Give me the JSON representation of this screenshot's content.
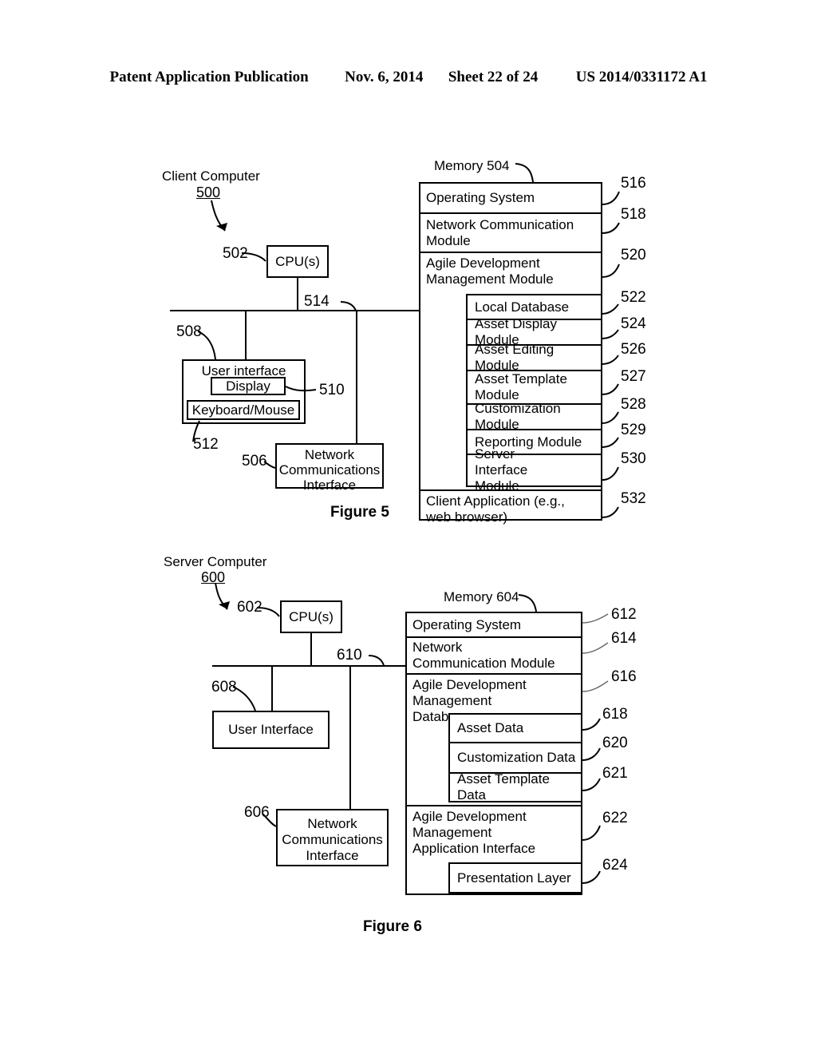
{
  "header": {
    "publication": "Patent Application Publication",
    "date": "Nov. 6, 2014",
    "sheet": "Sheet 22 of 24",
    "number": "US 2014/0331172 A1"
  },
  "figure5": {
    "caption": "Figure 5",
    "title": "Client Computer",
    "title_ref": "500",
    "cpu": {
      "label": "CPU(s)",
      "ref": "502"
    },
    "bus_ref": "514",
    "user_interface": {
      "label": "User interface",
      "ref": "508",
      "display": {
        "label": "Display",
        "ref": "510"
      },
      "keyboard": {
        "label": "Keyboard/Mouse",
        "ref": "512"
      }
    },
    "network_interface": {
      "label": "Network Communications Interface",
      "ref": "506"
    },
    "memory": {
      "label": "Memory 504",
      "rows": [
        {
          "label": "Operating System",
          "ref": "516",
          "level": "top"
        },
        {
          "label": "Network Communication Module",
          "ref": "518",
          "level": "top"
        },
        {
          "label": "Agile Development Management Module",
          "ref": "520",
          "level": "top"
        },
        {
          "label": "Local Database",
          "ref": "522",
          "level": "sub"
        },
        {
          "label": "Asset Display Module",
          "ref": "524",
          "level": "sub"
        },
        {
          "label": "Asset Editing Module",
          "ref": "526",
          "level": "sub"
        },
        {
          "label": "Asset Template Module",
          "ref": "527",
          "level": "sub"
        },
        {
          "label": "Customization Module",
          "ref": "528",
          "level": "sub"
        },
        {
          "label": "Reporting Module",
          "ref": "529",
          "level": "sub"
        },
        {
          "label": "Server Interface Module",
          "ref": "530",
          "level": "sub"
        },
        {
          "label": "Client Application (e.g., web browser)",
          "ref": "532",
          "level": "top"
        }
      ]
    }
  },
  "figure6": {
    "caption": "Figure 6",
    "title": "Server Computer",
    "title_ref": "600",
    "cpu": {
      "label": "CPU(s)",
      "ref": "602"
    },
    "bus_ref": "610",
    "user_interface": {
      "label": "User Interface",
      "ref": "608"
    },
    "network_interface": {
      "label": "Network Communications Interface",
      "ref": "606"
    },
    "memory": {
      "label": "Memory 604",
      "rows": [
        {
          "label": "Operating System",
          "ref": "612",
          "level": "top"
        },
        {
          "label": "Network Communication Module",
          "ref": "614",
          "level": "top"
        },
        {
          "label": "Agile Development Management Database",
          "ref": "616",
          "level": "top"
        },
        {
          "label": "Asset Data",
          "ref": "618",
          "level": "sub"
        },
        {
          "label": "Customization Data",
          "ref": "620",
          "level": "sub"
        },
        {
          "label": "Asset Template Data",
          "ref": "621",
          "level": "sub"
        },
        {
          "label": "Agile Development Management Application Interface",
          "ref": "622",
          "level": "top"
        },
        {
          "label": "Presentation Layer",
          "ref": "624",
          "level": "sub"
        }
      ]
    }
  }
}
